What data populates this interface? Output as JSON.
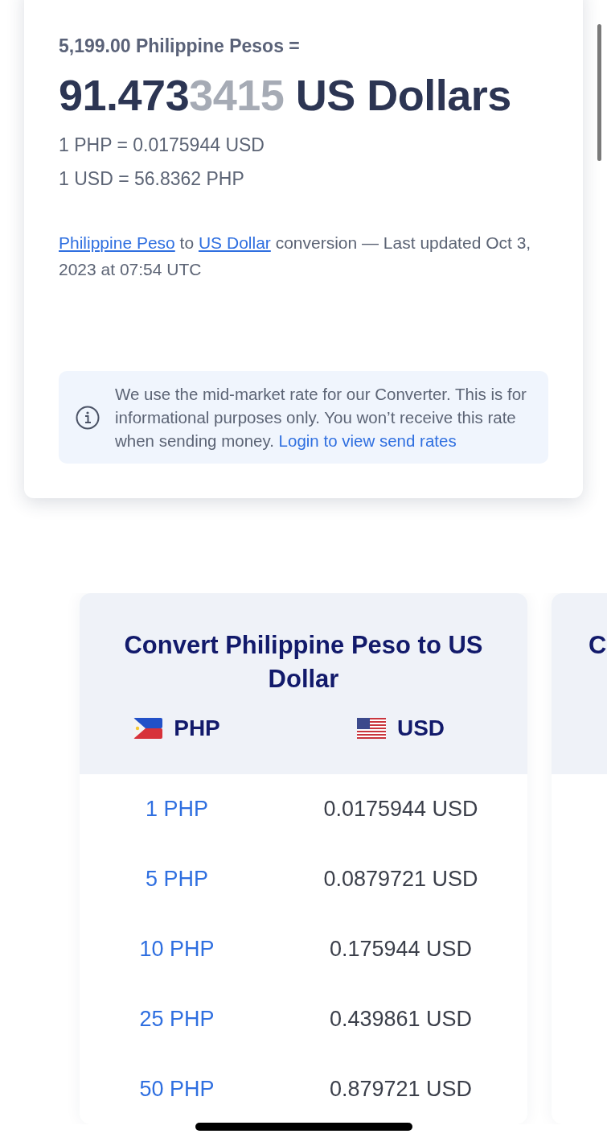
{
  "result": {
    "from_line": "5,199.00 Philippine Pesos =",
    "amount_main": "91.473",
    "amount_faded": "3415",
    "amount_currency": "US Dollars",
    "rates": [
      "1 PHP = 0.0175944 USD",
      "1 USD = 56.8362 PHP"
    ],
    "source": {
      "link_from": "Philippine Peso",
      "to_word": "to",
      "link_to": "US Dollar",
      "rest": "conversion — Last updated Oct 3, 2023 at 07:54 UTC"
    },
    "notice": {
      "text": "We use the mid-market rate for our Converter. This is for informational purposes only. You won’t receive this rate when sending money.",
      "link": "Login to view send rates"
    }
  },
  "tables": [
    {
      "title": "Convert Philippine Peso to US Dollar",
      "columns": [
        {
          "code": "PHP",
          "kind": "ph"
        },
        {
          "code": "USD",
          "kind": "us"
        }
      ],
      "rows": [
        [
          "1 PHP",
          "0.0175944 USD"
        ],
        [
          "5 PHP",
          "0.0879721 USD"
        ],
        [
          "10 PHP",
          "0.175944 USD"
        ],
        [
          "25 PHP",
          "0.439861 USD"
        ],
        [
          "50 PHP",
          "0.879721 USD"
        ]
      ]
    },
    {
      "title": "C"
    }
  ]
}
